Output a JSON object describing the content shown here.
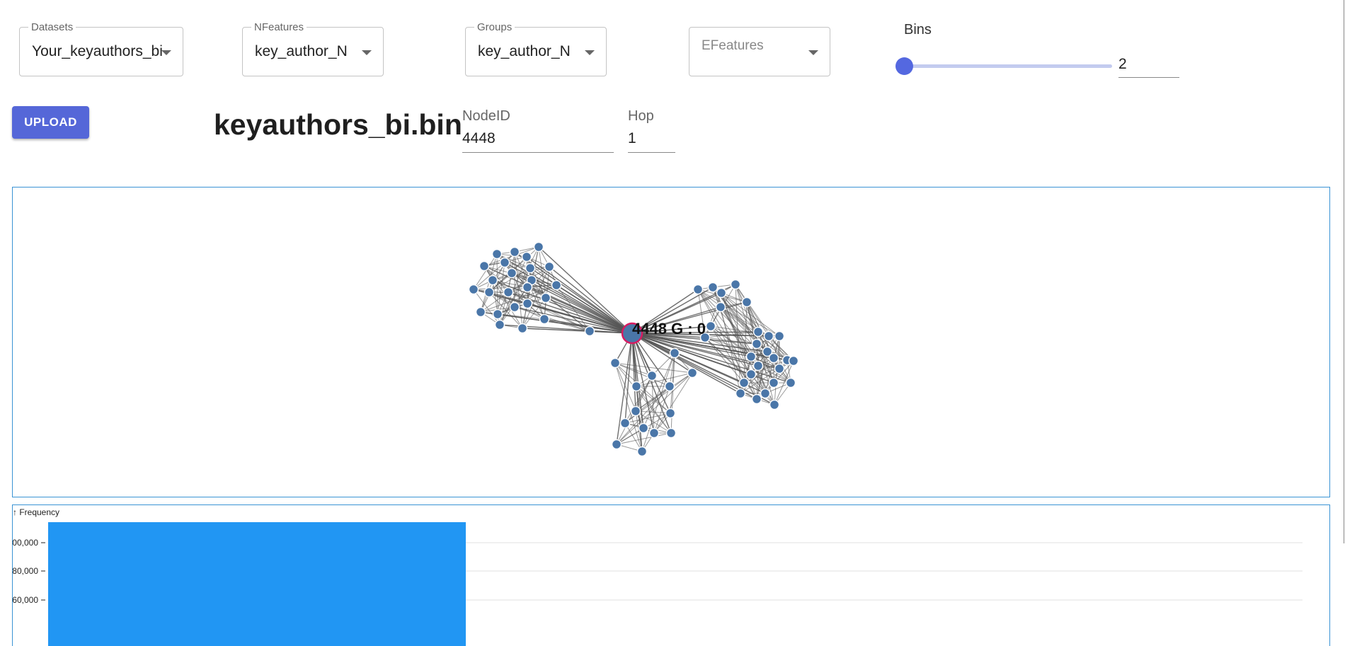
{
  "controls": {
    "datasets": {
      "label": "Datasets",
      "value": "Your_keyauthors_bi"
    },
    "nfeatures": {
      "label": "NFeatures",
      "value": "key_author_N"
    },
    "groups": {
      "label": "Groups",
      "value": "key_author_N"
    },
    "efeatures": {
      "label": "EFeatures",
      "value": ""
    },
    "bins": {
      "label": "Bins",
      "value": "2",
      "slider_fraction": 0
    }
  },
  "upload_label": "UPLOAD",
  "file_title": "keyauthors_bi.bin",
  "node_id": {
    "label": "NodeID",
    "value": "4448"
  },
  "hop": {
    "label": "Hop",
    "value": "1"
  },
  "graph": {
    "center_label": "4448 G : 0",
    "node_color": "#4a76a8",
    "center_stroke": "#d81b60"
  },
  "histogram": {
    "y_label": "↑ Frequency",
    "ticks": [
      "00,000",
      "80,000",
      "60,000"
    ],
    "bar_color": "#2196f3"
  },
  "colors": {
    "accent": "#5567d8",
    "panel_border": "#3a93d4"
  }
}
